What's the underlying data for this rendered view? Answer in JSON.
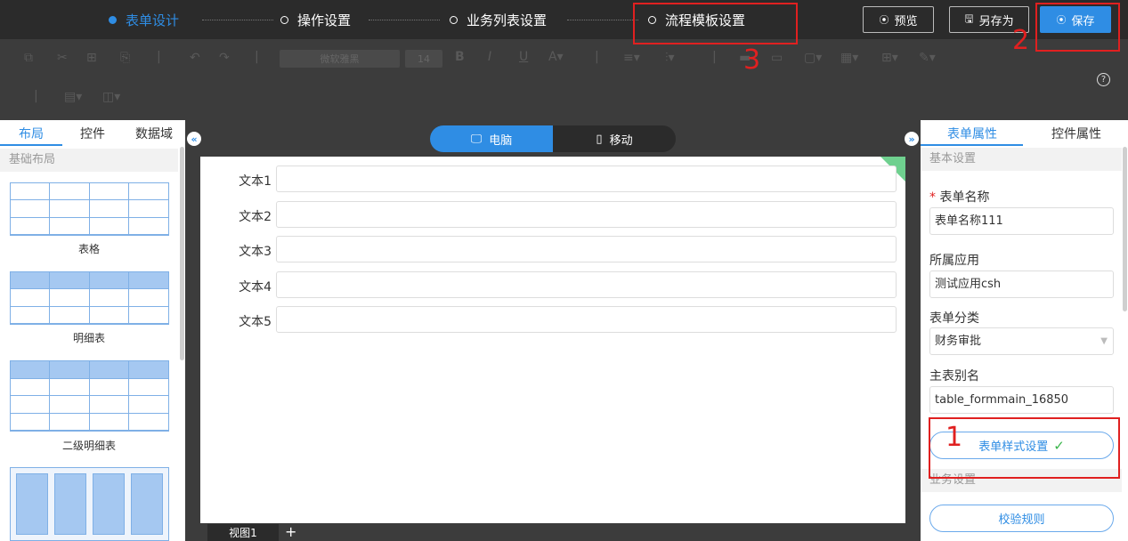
{
  "steps": [
    {
      "label": "表单设计",
      "active": true
    },
    {
      "label": "操作设置",
      "active": false
    },
    {
      "label": "业务列表设置",
      "active": false
    },
    {
      "label": "流程模板设置",
      "active": false
    }
  ],
  "top_actions": {
    "preview": "预览",
    "save_as": "另存为",
    "save": "保存"
  },
  "toolbar": {
    "font_family": "微软雅黑",
    "font_size": "14",
    "help": "?"
  },
  "left_panel": {
    "tabs": [
      "布局",
      "控件",
      "数据域"
    ],
    "section": "基础布局",
    "items": [
      "表格",
      "明细表",
      "二级明细表"
    ]
  },
  "device_toggle": {
    "pc": "电脑",
    "mobile": "移动"
  },
  "form_fields": [
    "文本1",
    "文本2",
    "文本3",
    "文本4",
    "文本5"
  ],
  "views": {
    "current": "视图1",
    "add": "+"
  },
  "right_panel": {
    "tabs": [
      "表单属性",
      "控件属性"
    ],
    "basic_section": "基本设置",
    "form_name_label": "表单名称",
    "form_name_value": "表单名称111",
    "app_label": "所属应用",
    "app_value": "测试应用csh",
    "category_label": "表单分类",
    "category_value": "财务审批",
    "alias_label": "主表别名",
    "alias_value": "table_formmain_16850",
    "style_button": "表单样式设置",
    "business_section": "业务设置",
    "validate_button": "校验规则"
  },
  "annotations": [
    "1",
    "2",
    "3"
  ],
  "colors": {
    "accent": "#2f8de4",
    "annotation": "#e02020",
    "topbar": "#2b2b2b",
    "toolbar": "#3c3c3c"
  }
}
